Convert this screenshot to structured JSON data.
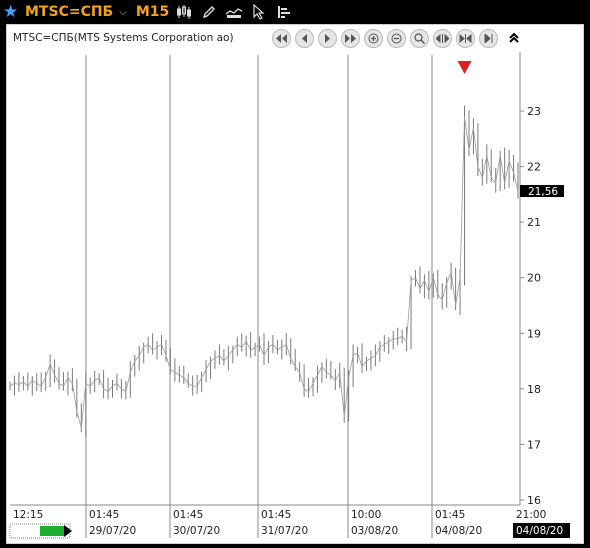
{
  "toolbar": {
    "symbol": "MTSC=СПБ",
    "timeframe": "M15"
  },
  "chart": {
    "title": "MTSC=СПБ(MTS Systems Corporation ao)",
    "last_price": "21,56",
    "accent": "#f3a21c",
    "last_price_bg": "#000000",
    "marker_color": "#e02020"
  },
  "chart_data": {
    "type": "candlestick",
    "instrument": "MTSC=СПБ(MTS Systems Corporation ao)",
    "timeframe": "M15",
    "y_ticks": [
      16,
      17,
      18,
      19,
      20,
      21,
      22,
      23
    ],
    "ylim": [
      16,
      23.9
    ],
    "last_price": 21.56,
    "sessions": [
      {
        "time": "12:15",
        "date": ""
      },
      {
        "time": "01:45",
        "date": "29/07/20"
      },
      {
        "time": "01:45",
        "date": "30/07/20"
      },
      {
        "time": "01:45",
        "date": "31/07/20"
      },
      {
        "time": "10:00",
        "date": "03/08/20"
      },
      {
        "time": "01:45",
        "date": "04/08/20"
      },
      {
        "time": "21:00",
        "date": "04/08/20"
      }
    ],
    "price_path": [
      18.05,
      18.1,
      18.08,
      18.12,
      18.05,
      18.15,
      18.1,
      18.05,
      18.2,
      18.45,
      18.25,
      18.1,
      18.05,
      18.2,
      18.1,
      17.6,
      17.3,
      18.1,
      18.05,
      18.15,
      18.2,
      18.0,
      17.95,
      18.05,
      18.1,
      18.0,
      17.95,
      18.3,
      18.5,
      18.6,
      18.75,
      18.8,
      18.7,
      18.75,
      18.8,
      18.6,
      18.35,
      18.3,
      18.25,
      18.2,
      18.1,
      18.05,
      18.05,
      18.2,
      18.35,
      18.5,
      18.55,
      18.6,
      18.5,
      18.6,
      18.7,
      18.8,
      18.75,
      18.85,
      18.7,
      18.75,
      18.8,
      18.6,
      18.75,
      18.8,
      18.7,
      18.75,
      18.8,
      18.55,
      18.4,
      18.3,
      18.0,
      17.95,
      18.1,
      18.25,
      18.4,
      18.3,
      18.25,
      18.15,
      18.3,
      17.5,
      18.2,
      18.6,
      18.65,
      18.4,
      18.5,
      18.55,
      18.6,
      18.75,
      18.8,
      18.85,
      18.9,
      18.9,
      18.95,
      18.85,
      19.95,
      20.0,
      19.8,
      19.95,
      19.75,
      20.0,
      19.7,
      19.6,
      19.9,
      20.1,
      19.5,
      20.0,
      22.9,
      22.3,
      22.7,
      22.0,
      21.8,
      22.2,
      21.8,
      21.7,
      22.2,
      21.7,
      22.1,
      21.9,
      21.56
    ]
  }
}
